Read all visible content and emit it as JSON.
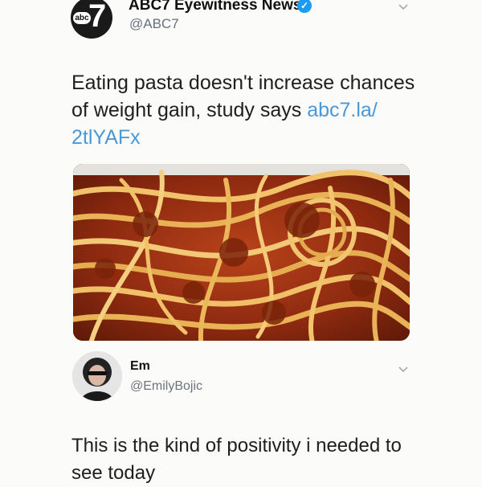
{
  "tweet": {
    "logo_badge": "abc",
    "logo_number": "7",
    "display_name": "ABC7 Eyewitness News",
    "verified": "✓",
    "handle": "@ABC7",
    "text_before_link": "Eating pasta doesn't increase chances of weight gain, study says ",
    "link_text": "abc7.la/ 2tlYAFx",
    "image_icon": "spaghetti-bolognese-photo",
    "colors": {
      "link": "#4a98d6",
      "verified": "#1d9bf0",
      "handle": "#67707a"
    }
  },
  "reply": {
    "display_name": "Em",
    "handle": "@EmilyBojic",
    "text": "This is the kind of positivity i needed to see today",
    "avatar_icon": "user-avatar-photo"
  },
  "icons": {
    "menu_chevron": "chevron-down-icon"
  }
}
